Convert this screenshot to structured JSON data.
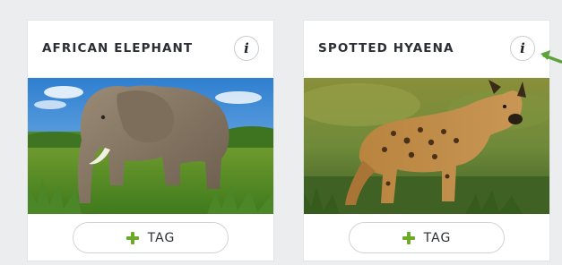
{
  "cards": [
    {
      "title": "AFRICAN ELEPHANT",
      "info_icon": "i",
      "image_subject": "african-elephant",
      "tag_label": "TAG"
    },
    {
      "title": "SPOTTED HYAENA",
      "info_icon": "i",
      "image_subject": "spotted-hyaena",
      "tag_label": "TAG"
    }
  ],
  "colors": {
    "accent_green": "#6cab27",
    "arrow_green": "#5fa23a",
    "title_text": "#2b2e33",
    "background": "#ebedef"
  },
  "icons": {
    "info": "info-icon",
    "plus": "plus-icon",
    "pointer": "arrow-pointer-icon"
  }
}
